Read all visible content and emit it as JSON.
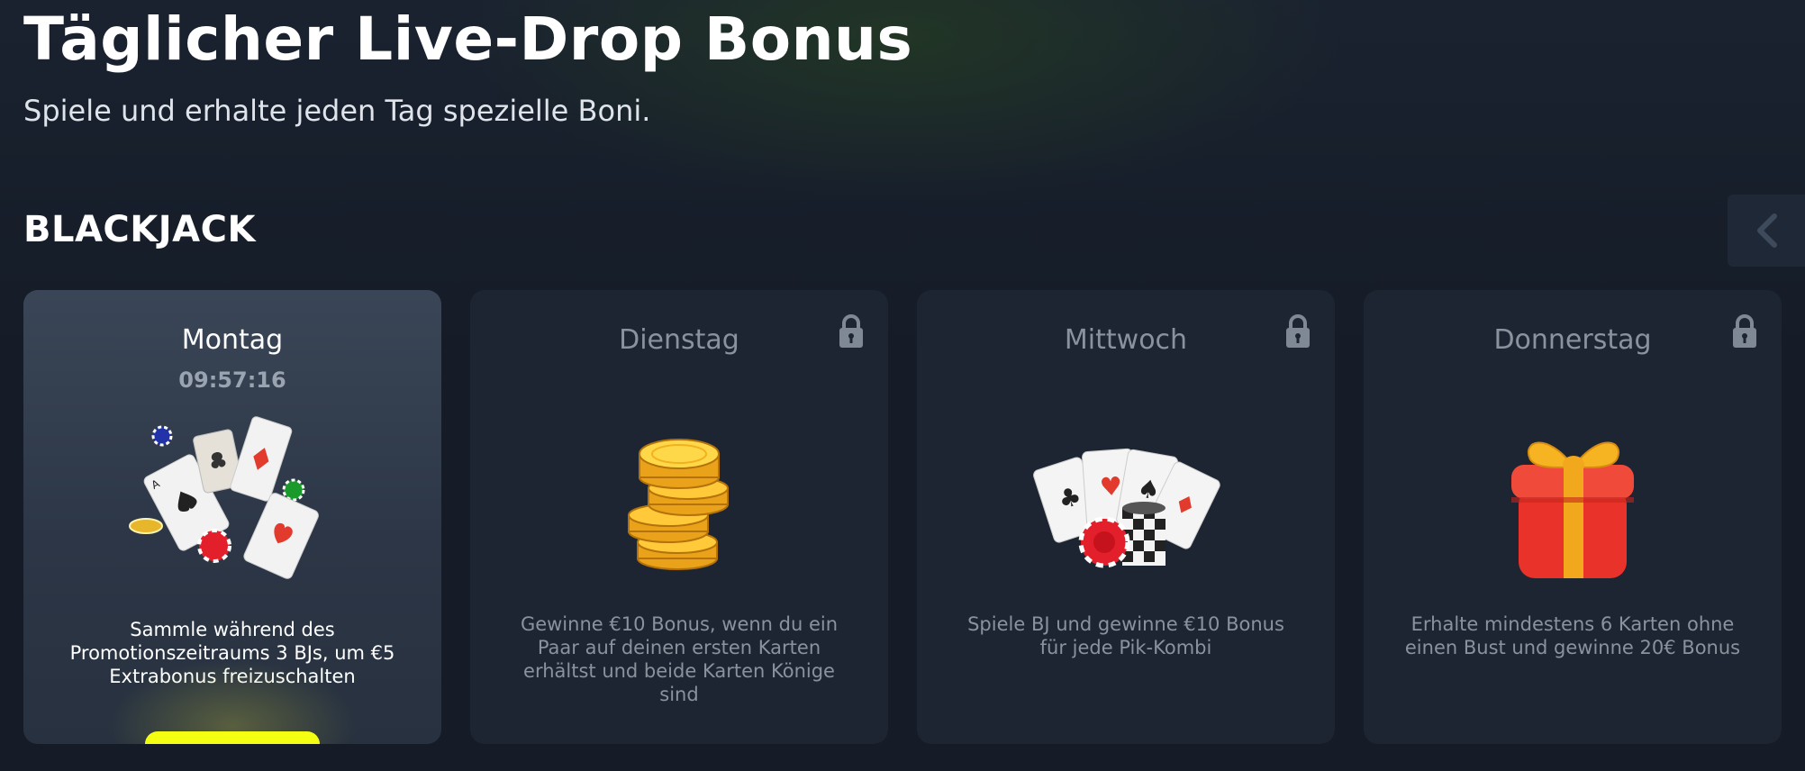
{
  "header": {
    "title": "Täglicher Live-Drop Bonus",
    "subtitle": "Spiele und erhalte jeden Tag spezielle Boni."
  },
  "section": {
    "title": "BLACKJACK"
  },
  "navigation": {
    "prev_icon": "chevron-left-icon"
  },
  "cards": [
    {
      "day": "Montag",
      "timer": "09:57:16",
      "description": "Sammle während des Promotionszeitraums 3 BJs, um €5 Extrabonus freizuschalten",
      "image": "cards-and-chips",
      "locked": false
    },
    {
      "day": "Dienstag",
      "description": "Gewinne €10 Bonus, wenn du ein Paar auf deinen ersten Karten erhältst und beide Karten Könige sind",
      "image": "gold-coins-stack",
      "locked": true
    },
    {
      "day": "Mittwoch",
      "description": "Spiele BJ und gewinne €10 Bonus für jede Pik-Kombi",
      "image": "playing-cards-with-chips",
      "locked": true
    },
    {
      "day": "Donnerstag",
      "description": "Erhalte mindestens 6 Karten ohne einen Bust und gewinne 20€ Bonus",
      "image": "gift-box",
      "locked": true
    }
  ],
  "colors": {
    "background": "#151c27",
    "card": "#1e2532",
    "card_active": "#2c3646",
    "accent_button": "#f5ff12",
    "muted_text": "#8a929e"
  }
}
